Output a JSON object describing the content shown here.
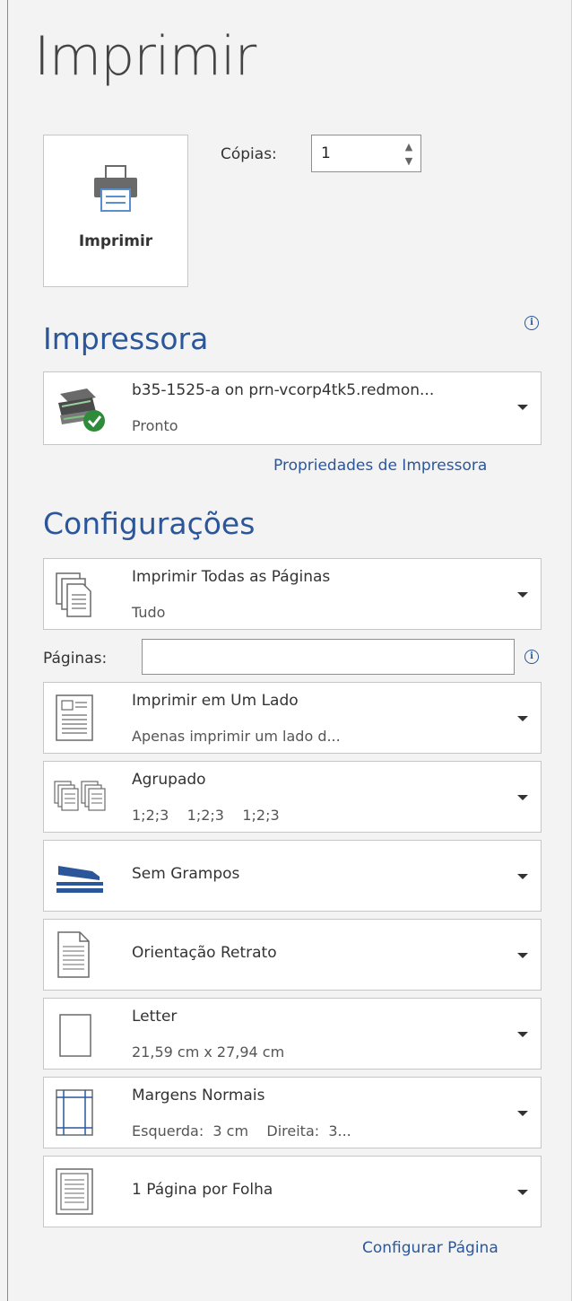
{
  "title": "Imprimir",
  "print_button": {
    "label": "Imprimir",
    "icon": "printer-icon"
  },
  "copies": {
    "label": "Cópias:",
    "value": "1"
  },
  "printer_section": {
    "title": "Impressora",
    "selected": {
      "name": "b35-1525-a on prn-vcorp4tk5.redmon...",
      "status": "Pronto",
      "icon": "printer-ready-icon"
    },
    "properties_link": "Propriedades de Impressora"
  },
  "settings_section": {
    "title": "Configurações",
    "pages_label": "Páginas:",
    "pages_value": "",
    "items": [
      {
        "name": "print-range",
        "line1": "Imprimir Todas as Páginas",
        "line2": "Tudo",
        "icon": "all-pages-icon"
      },
      {
        "name": "sides",
        "line1": "Imprimir em Um Lado",
        "line2": "Apenas imprimir um lado d...",
        "icon": "one-sided-icon"
      },
      {
        "name": "collation",
        "line1": "Agrupado",
        "line2": "1;2;3    1;2;3    1;2;3",
        "icon": "collated-icon"
      },
      {
        "name": "staple",
        "line1": "Sem Grampos",
        "line2": "",
        "icon": "stapler-icon"
      },
      {
        "name": "orientation",
        "line1": "Orientação Retrato",
        "line2": "",
        "icon": "portrait-icon"
      },
      {
        "name": "paper-size",
        "line1": "Letter",
        "line2": "21,59 cm x 27,94 cm",
        "icon": "paper-size-icon"
      },
      {
        "name": "margins",
        "line1": "Margens Normais",
        "line2": "Esquerda:  3 cm    Direita:  3...",
        "icon": "margins-icon"
      },
      {
        "name": "pages-per-sheet",
        "line1": "1 Página por Folha",
        "line2": "",
        "icon": "pages-per-sheet-icon"
      }
    ],
    "page_setup_link": "Configurar Página"
  },
  "colors": {
    "accent": "#2b579a",
    "background": "#f3f3f3",
    "border": "#c6c6c6",
    "success": "#2e8b3a"
  }
}
